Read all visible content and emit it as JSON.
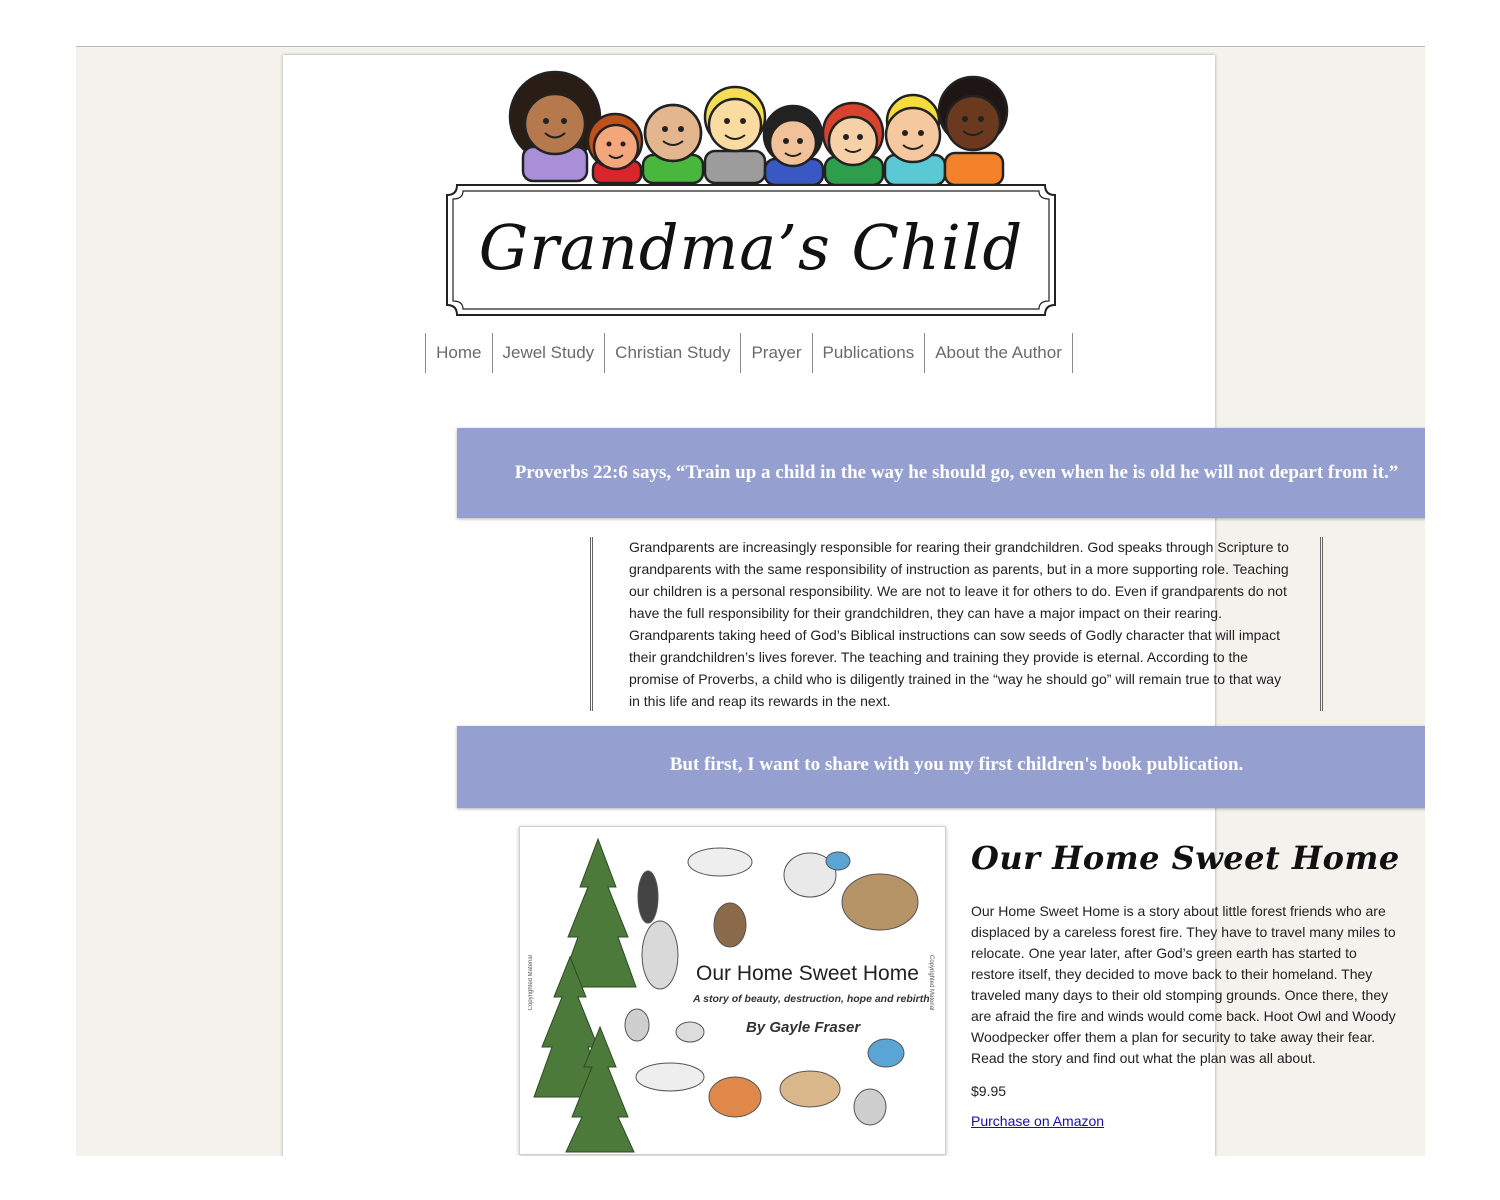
{
  "site": {
    "title": "Grandma’s Child"
  },
  "nav": {
    "items": [
      {
        "label": "Home"
      },
      {
        "label": "Jewel Study"
      },
      {
        "label": "Christian Study"
      },
      {
        "label": "Prayer"
      },
      {
        "label": "Publications"
      },
      {
        "label": "About the Author"
      }
    ]
  },
  "banners": {
    "verse": "Proverbs 22:6 says, “Train up a child in the way he should go, even when he is old he will not depart from it.”",
    "announcement": "But first, I want to share with you my first children's book publication."
  },
  "intro": {
    "text": "Grandparents are increasingly responsible for rearing their grandchildren. God speaks through Scripture to grandparents with the same responsibility of instruction as parents, but in a more supporting role. Teaching our children is a personal responsibility. We are not to leave it for others to do. Even if grandparents do not have the full responsibility for their grandchildren, they can have a major impact on their rearing. Grandparents taking heed of God’s Biblical instructions can sow seeds of Godly character that will impact their grandchildren’s lives forever. The teaching and training they provide is eternal. According to the promise of Proverbs, a child who is diligently trained in the “way he should go” will remain true to that way in this life and reap its rewards in the next."
  },
  "book": {
    "title": "Our Home Sweet Home",
    "cover_title": "Our Home Sweet Home",
    "cover_subtitle": "A story of beauty, destruction, hope and rebirth",
    "cover_author": "By Gayle Fraser",
    "cover_copyright": "Copyrighted Material",
    "description": "Our Home Sweet Home is a story about little forest friends who are displaced by a careless forest fire. They have to travel many miles to relocate. One year later, after God’s green earth has started to restore itself, they decided to move back to their homeland. They traveled many days to their old stomping grounds. Once there, they are afraid the fire and winds would come back. Hoot Owl and Woody Woodpecker offer them a plan for security to take away their fear. Read the story and find out what the plan was all about.",
    "price": "$9.95",
    "purchase_link": "Purchase on Amazon"
  },
  "colors": {
    "banner": "#95a0d1",
    "page_bg": "#f3f2ed",
    "link": "#1a0dab"
  }
}
